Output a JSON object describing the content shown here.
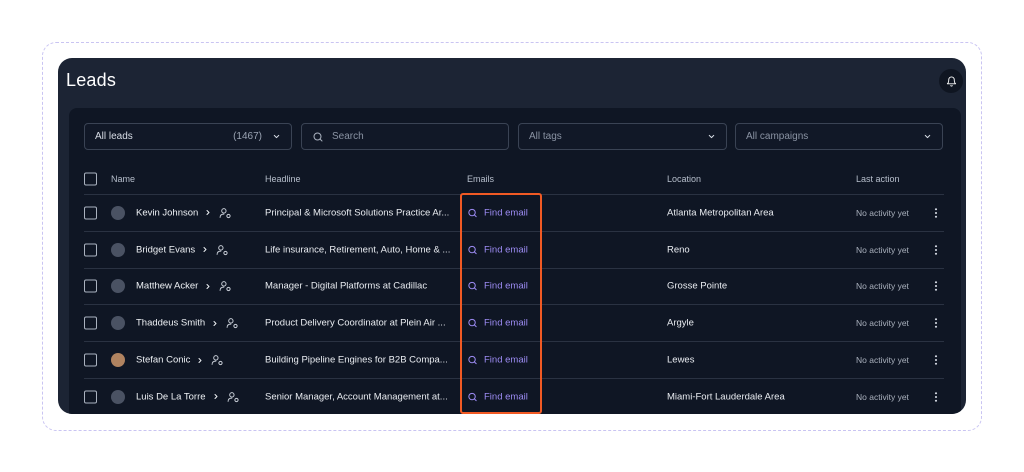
{
  "page": {
    "title": "Leads"
  },
  "filters": {
    "leads_label": "All leads",
    "leads_count": "(1467)",
    "search_placeholder": "Search",
    "tags_label": "All tags",
    "campaigns_label": "All campaigns"
  },
  "table": {
    "headers": {
      "name": "Name",
      "headline": "Headline",
      "emails": "Emails",
      "location": "Location",
      "last_action": "Last action"
    },
    "rows": [
      {
        "name": "Kevin Johnson",
        "headline": "Principal & Microsoft Solutions Practice Ar...",
        "email_action": "Find email",
        "location": "Atlanta Metropolitan Area",
        "last_action": "No activity yet"
      },
      {
        "name": "Bridget Evans",
        "headline": "Life insurance, Retirement, Auto, Home & ...",
        "email_action": "Find email",
        "location": "Reno",
        "last_action": "No activity yet"
      },
      {
        "name": "Matthew Acker",
        "headline": "Manager - Digital Platforms at Cadillac",
        "email_action": "Find email",
        "location": "Grosse Pointe",
        "last_action": "No activity yet"
      },
      {
        "name": "Thaddeus Smith",
        "headline": "Product Delivery Coordinator at Plein Air ...",
        "email_action": "Find email",
        "location": "Argyle",
        "last_action": "No activity yet"
      },
      {
        "name": "Stefan Conic",
        "headline": "Building Pipeline Engines for B2B Compa...",
        "email_action": "Find email",
        "location": "Lewes",
        "last_action": "No activity yet"
      },
      {
        "name": "Luis De La Torre",
        "headline": "Senior Manager, Account Management at...",
        "email_action": "Find email",
        "location": "Miami-Fort Lauderdale Area",
        "last_action": "No activity yet"
      }
    ]
  },
  "colors": {
    "background": "#1c2434",
    "panel": "#0f1624",
    "accent": "#9d8cf4",
    "highlight": "#f15a24"
  },
  "icons": [
    "bell-icon",
    "search-icon",
    "chevron-down-icon",
    "chevron-right-icon",
    "user-settings-icon",
    "more-vertical-icon"
  ]
}
